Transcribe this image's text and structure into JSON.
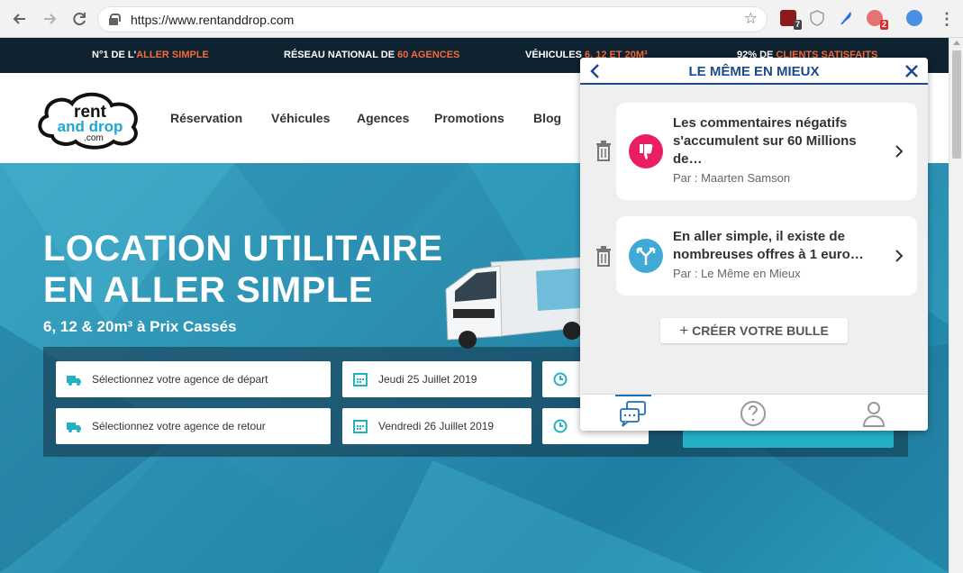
{
  "browser": {
    "url": "https://www.rentanddrop.com",
    "extensions": [
      {
        "name": "ublock-icon",
        "badge": "7",
        "color": "#8b0000"
      },
      {
        "name": "shield-icon",
        "badge": "",
        "color": "#9e9e9e"
      },
      {
        "name": "quill-icon",
        "badge": "",
        "color": "#1a73e8"
      },
      {
        "name": "bubble-extension-icon",
        "badge": "2",
        "color": "#d32f2f"
      },
      {
        "name": "profile-icon",
        "badge": "",
        "color": "#4a90e2"
      }
    ]
  },
  "topbar": {
    "item1_prefix": "N°1 DE L'",
    "item1_highlight": "ALLER SIMPLE",
    "item2_prefix": "RÉSEAU NATIONAL DE ",
    "item2_highlight": "60 AGENCES",
    "item3_prefix": "VÉHICULES ",
    "item3_highlight": "6, 12 ET 20M³",
    "item4_prefix": "92% DE ",
    "item4_highlight": "CLIENTS SATISFAITS"
  },
  "logo": {
    "line1": "rent",
    "line2": "and drop",
    "line3": ".com"
  },
  "menu": [
    "Réservation",
    "Véhicules",
    "Agences",
    "Promotions",
    "Blog"
  ],
  "hero": {
    "title_line1": "LOCATION UTILITAIRE",
    "title_line2": "EN ALLER SIMPLE",
    "subtitle": "6, 12 & 20m³ à Prix Cassés"
  },
  "form": {
    "departure_agency": "Sélectionnez votre agence de départ",
    "return_agency": "Sélectionnez votre agence de retour",
    "departure_date": "Jeudi 25 Juillet 2019",
    "return_date": "Vendredi 26 Juillet 2019",
    "departure_time": "",
    "return_time": ""
  },
  "popup": {
    "title": "LE MÊME EN MIEUX",
    "cards": [
      {
        "title": "Les commentaires négatifs s'accumulent sur 60 Millions de…",
        "author": "Par : Maarten Samson",
        "icon": "thumbs-down-icon",
        "color": "#e91e63"
      },
      {
        "title": "En aller simple, il existe de nombreuses offres à 1 euro…",
        "author": "Par : Le Même en Mieux",
        "icon": "split-arrows-icon",
        "color": "#3fa9d8"
      }
    ],
    "create_label": "CRÉER VOTRE BULLE",
    "tabs": [
      "chat-bubbles-icon",
      "help-icon",
      "user-icon"
    ]
  },
  "colors": {
    "brand_orange": "#f26a3b",
    "brand_navy": "#0f2230",
    "popup_blue": "#1e4a8c",
    "hero_teal": "#2c8fb0"
  }
}
